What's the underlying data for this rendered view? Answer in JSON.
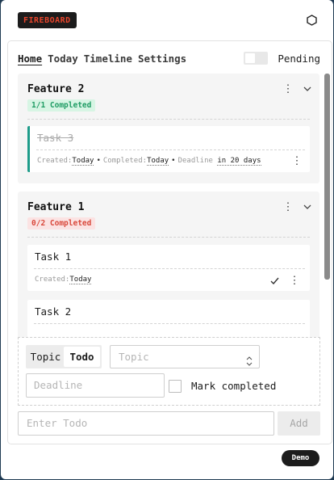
{
  "brand": {
    "label": "FIREBOARD"
  },
  "nav": {
    "tabs": [
      {
        "label": "Home",
        "active": true
      },
      {
        "label": "Today",
        "active": false
      },
      {
        "label": "Timeline",
        "active": false
      },
      {
        "label": "Settings",
        "active": false
      }
    ],
    "pending_label": "Pending",
    "pending_on": false
  },
  "features": [
    {
      "title": "Feature 2",
      "status": "1/1 Completed",
      "tasks": [
        {
          "title": "Task 3",
          "completed": true,
          "created_label": "Created:",
          "created": "Today",
          "completed_label": "Completed:",
          "completed_value": "Today",
          "deadline_label": "Deadline",
          "deadline": "in 20 days"
        }
      ]
    },
    {
      "title": "Feature 1",
      "status": "0/2 Completed",
      "tasks": [
        {
          "title": "Task 1",
          "completed": false,
          "created_label": "Created:",
          "created": "Today"
        },
        {
          "title": "Task 2",
          "completed": false
        }
      ]
    }
  ],
  "form": {
    "segment": {
      "options": [
        "Topic",
        "Todo"
      ],
      "selected": "Todo"
    },
    "topic_placeholder": "Topic",
    "deadline_placeholder": "Deadline",
    "mark_completed_label": "Mark completed",
    "todo_placeholder": "Enter Todo",
    "add_label": "Add"
  },
  "demo_label": "Demo",
  "colors": {
    "brand_bg": "#1c1c1c",
    "brand_text": "#e8452c",
    "complete_green": "#1e9c63",
    "incomplete_red": "#d9483b",
    "task_done_bar": "#1e9c8a"
  }
}
